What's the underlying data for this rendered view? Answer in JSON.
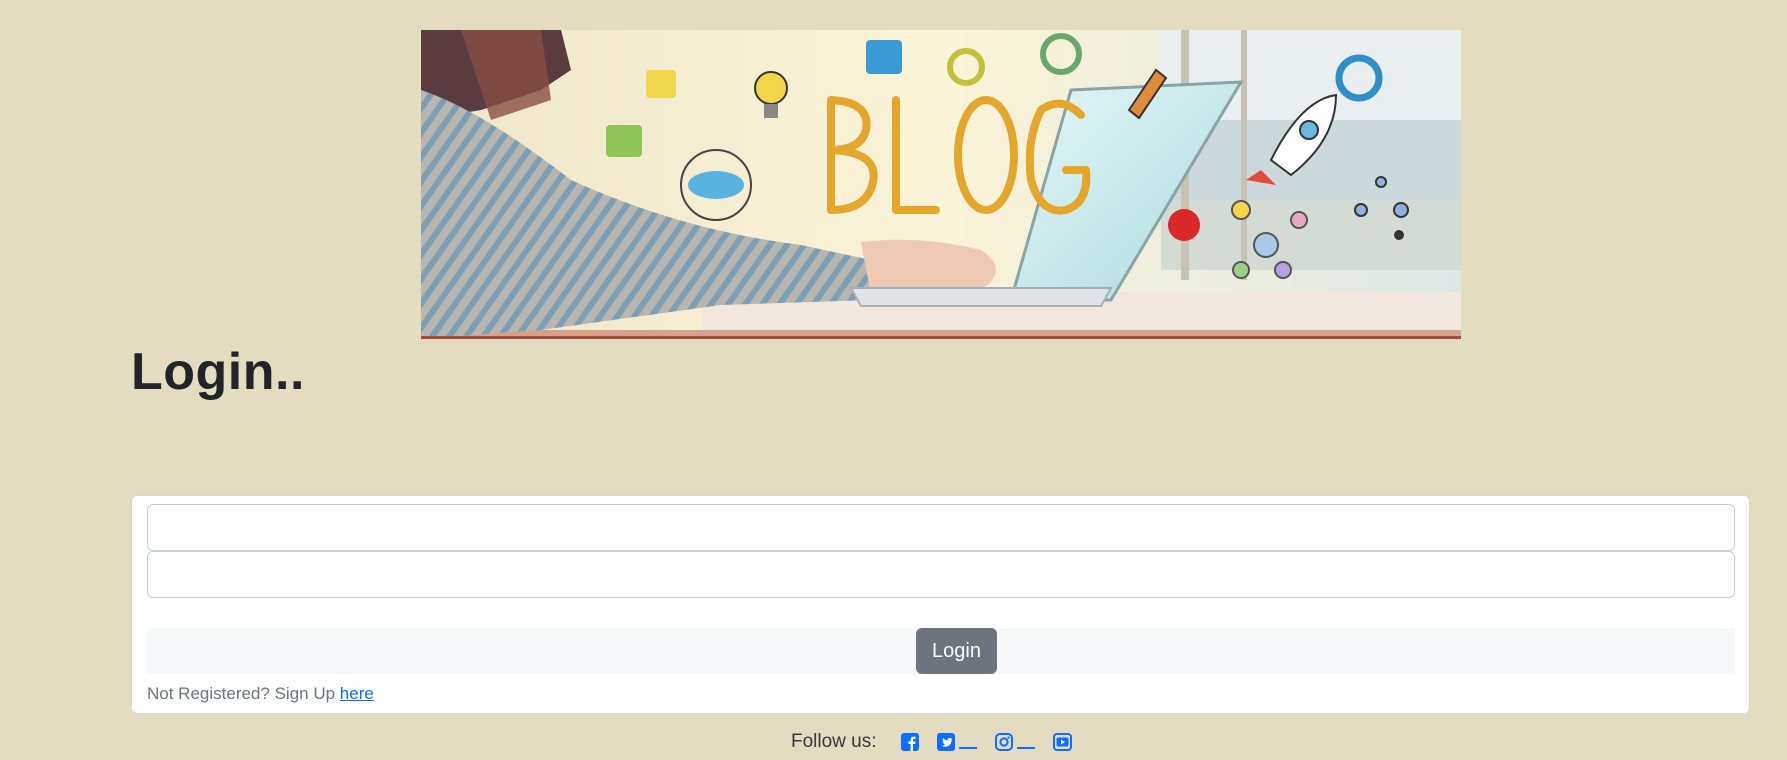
{
  "banner": {
    "alt_text": "BLOG"
  },
  "page": {
    "title": "Login.."
  },
  "form": {
    "username_placeholder": "",
    "password_placeholder": "",
    "login_button_label": "Login",
    "signup_prompt": "Not Registered? Sign Up",
    "signup_link_label": "here"
  },
  "footer": {
    "follow_label": "Follow us:",
    "social_icons": [
      "facebook-icon",
      "twitter-icon",
      "instagram-icon",
      "youtube-icon"
    ]
  },
  "colors": {
    "background": "#e4dcc0",
    "button": "#6c757d",
    "link": "#0d6efd"
  }
}
